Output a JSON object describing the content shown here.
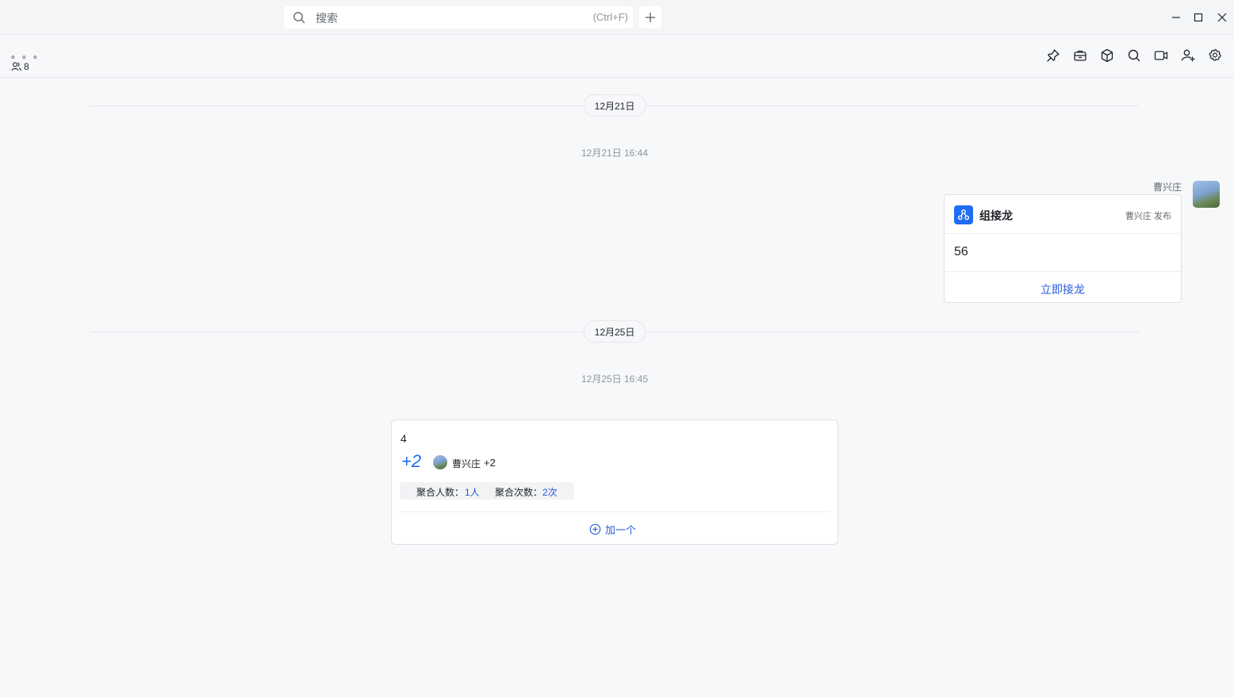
{
  "titlebar": {
    "search_placeholder": "搜索",
    "search_shortcut": "(Ctrl+F)"
  },
  "chat": {
    "title": "。。。",
    "member_count": "8"
  },
  "messages": {
    "date1": "12月21日",
    "time1": "12月21日 16:44",
    "sender": "曹兴庄",
    "card": {
      "title": "组接龙",
      "meta": "曹兴庄 发布",
      "body": "56",
      "action": "立即接龙"
    },
    "date2": "12月25日",
    "time2": "12月25日 16:45",
    "agg": {
      "text": "4",
      "plus": "+2",
      "user_name": "曹兴庄",
      "user_count": "+2",
      "people_label": "聚合人数：",
      "people_value": "1人",
      "times_label": "聚合次数：",
      "times_value": "2次",
      "add_label": "加一个"
    }
  }
}
